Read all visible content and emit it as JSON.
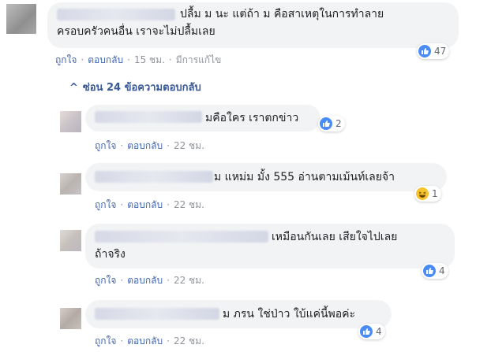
{
  "main_comment": {
    "line1": "ปลื้ม ม นะ แต่ถ้า ม คือสาเหตุในการทำลาย",
    "line2": "ครอบครัวคนอื่น เราจะไม่ปลื้มเลย",
    "like_label": "ถูกใจ",
    "reply_label": "ตอบกลับ",
    "time": "15 ชม.",
    "edited": "มีการแก้ไข",
    "reactions": "47"
  },
  "toggle": {
    "label": "ซ่อน 24 ข้อความตอบกลับ"
  },
  "replies": [
    {
      "line1": "มคือใคร เราตกข่าว",
      "line2": "",
      "like_label": "ถูกใจ",
      "reply_label": "ตอบกลับ",
      "time": "22 ชม.",
      "reactions": "2",
      "reaction_icon": "like-icon"
    },
    {
      "line1": "ม แหม่ม มั้ง 555 อ่านตามเม้นท์เลยจ้า",
      "line2": "",
      "like_label": "ถูกใจ",
      "reply_label": "ตอบกลับ",
      "time": "22 ชม.",
      "reactions": "1",
      "reaction_icon": "haha-icon"
    },
    {
      "line1": "เหมือนกันเลย เสียใจไปเลย",
      "line2": "ถ้าจริง",
      "like_label": "ถูกใจ",
      "reply_label": "ตอบกลับ",
      "time": "22 ชม.",
      "reactions": "4",
      "reaction_icon": "like-icon"
    },
    {
      "line1": "ม ภรน ใช่ป่าว ใบ้แค่นี้พอค่ะ",
      "line2": "",
      "like_label": "ถูกใจ",
      "reply_label": "ตอบกลับ",
      "time": "22 ชม.",
      "reactions": "4",
      "reaction_icon": "like-icon"
    }
  ],
  "colors": {
    "link": "#4267b2",
    "meta": "#90949c",
    "bubble": "#f2f3f5",
    "like": "#4a8cf7"
  }
}
